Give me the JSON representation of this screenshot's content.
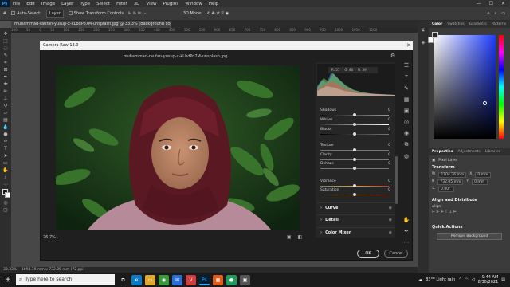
{
  "app": {
    "menu": [
      "File",
      "Edit",
      "Image",
      "Layer",
      "Type",
      "Select",
      "Filter",
      "3D",
      "View",
      "Plugins",
      "Window",
      "Help"
    ],
    "window_buttons": [
      "—",
      "☐",
      "✕"
    ]
  },
  "options_bar": {
    "auto_select_label": "Auto-Select:",
    "auto_select_value": "Layer",
    "transform_label": "Show Transform Controls",
    "mode_label": "3D Mode:"
  },
  "document": {
    "tab_title": "muhammad-raufan-yusup-x-kLbdPo7M-unsplash.jpg @ 33.3% (Background copy, RGB/8) *",
    "status_zoom": "33.33%",
    "status_dims": "1098.19 mm x 732.05 mm (72 ppi)",
    "ruler_ticks": [
      "100",
      "50",
      "0",
      "50",
      "100",
      "150",
      "200",
      "250",
      "300",
      "350",
      "400",
      "450",
      "500",
      "550",
      "600",
      "650",
      "700",
      "750",
      "800",
      "850",
      "900",
      "950",
      "1000",
      "1050",
      "1100"
    ]
  },
  "camera_raw": {
    "title": "Camera Raw 13.0",
    "filename": "muhammad-raufan-yusup-x-kLbdPo7M-unsplash.jpg",
    "rgb": {
      "r": "R: 57",
      "g": "G: 80",
      "b": "B: 39"
    },
    "sliders": [
      {
        "label": "Shadows",
        "value": "0"
      },
      {
        "label": "Whites",
        "value": "0"
      },
      {
        "label": "Blacks",
        "value": "0"
      },
      {
        "label": "Texture",
        "value": "0"
      },
      {
        "label": "Clarity",
        "value": "0"
      },
      {
        "label": "Dehaze",
        "value": "0"
      },
      {
        "label": "Vibrance",
        "value": "0"
      },
      {
        "label": "Saturation",
        "value": "0"
      }
    ],
    "sections": [
      {
        "label": "Curve"
      },
      {
        "label": "Detail"
      },
      {
        "label": "Color Mixer"
      }
    ],
    "zoom": "26.7%",
    "ok_label": "OK",
    "cancel_label": "Cancel"
  },
  "color_panel": {
    "tabs": [
      "Color",
      "Swatches",
      "Gradients",
      "Patterns"
    ],
    "active_tab": "Color",
    "hue_accent": "#1e3cff"
  },
  "properties_panel": {
    "tabs": [
      "Properties",
      "Adjustments",
      "Libraries"
    ],
    "layer_type": "Pixel Layer",
    "transform_title": "Transform",
    "w_value": "1104.26 mm",
    "h_value": "732.05 mm",
    "x_value": "0 mm",
    "y_value": "0 mm",
    "angle_value": "0.00°",
    "align_title": "Align and Distribute",
    "align_sub": "Align:",
    "quick_actions_title": "Quick Actions",
    "remove_bg_label": "Remove Background"
  },
  "taskbar": {
    "search_placeholder": "Type here to search",
    "weather": "83°F Light rain",
    "time": "9:44 AM",
    "date": "8/30/2021",
    "pinned": [
      {
        "name": "task-view",
        "label": "⧉",
        "color": "#1b1b1b"
      },
      {
        "name": "edge",
        "label": "e",
        "color": "#0a7ac7"
      },
      {
        "name": "file-explorer",
        "label": "▭",
        "color": "#e0a82e"
      },
      {
        "name": "chrome",
        "label": "◉",
        "color": "#3a9a3a"
      },
      {
        "name": "mail",
        "label": "✉",
        "color": "#2a6fd6"
      },
      {
        "name": "vivaldi",
        "label": "V",
        "color": "#d23c3c"
      },
      {
        "name": "photoshop",
        "label": "Ps",
        "color": "#001e36"
      },
      {
        "name": "app-orange",
        "label": "▦",
        "color": "#e35b1a"
      },
      {
        "name": "app-green",
        "label": "●",
        "color": "#1f9c5a"
      },
      {
        "name": "app-misc",
        "label": "▣",
        "color": "#555"
      }
    ]
  }
}
